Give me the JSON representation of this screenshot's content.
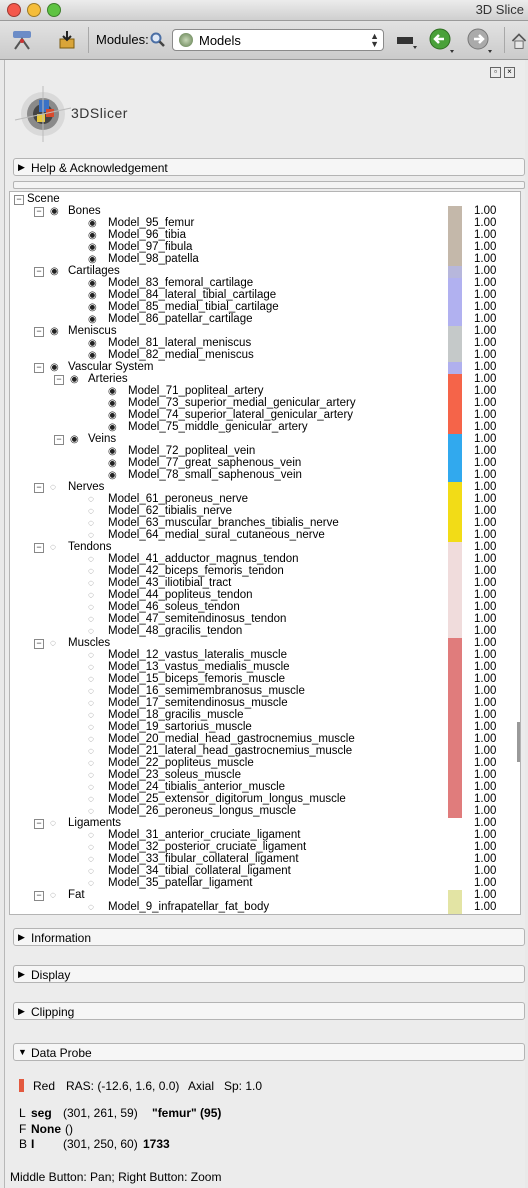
{
  "window": {
    "title": "3D Slice"
  },
  "toolbar": {
    "modules_label": "Modules:",
    "module_selected": "Models",
    "icons": [
      "dicom-icon",
      "save-icon",
      "search-icon",
      "models-icon",
      "layout-icon",
      "back-icon",
      "forward-icon",
      "home-icon"
    ]
  },
  "logo": {
    "text": "3DSlicer"
  },
  "sections": {
    "help": "Help & Acknowledgement",
    "information": "Information",
    "display": "Display",
    "clipping": "Clipping",
    "data_probe": "Data Probe"
  },
  "tree": {
    "root": "Scene",
    "rows": [
      {
        "label": "Bones",
        "type": "group",
        "level": 1,
        "color": "#c4b8aa",
        "opacity": "1.00"
      },
      {
        "label": "Model_95_femur",
        "type": "leaf",
        "level": 2,
        "color": "#c4b8aa",
        "opacity": "1.00"
      },
      {
        "label": "Model_96_tibia",
        "type": "leaf",
        "level": 2,
        "color": "#c4b8aa",
        "opacity": "1.00"
      },
      {
        "label": "Model_97_fibula",
        "type": "leaf",
        "level": 2,
        "color": "#c4b8aa",
        "opacity": "1.00"
      },
      {
        "label": "Model_98_patella",
        "type": "leaf",
        "level": 2,
        "color": "#c4b8aa",
        "opacity": "1.00"
      },
      {
        "label": "Cartilages",
        "type": "group",
        "level": 1,
        "color": "#b7b7dc",
        "opacity": "1.00"
      },
      {
        "label": "Model_83_femoral_cartilage",
        "type": "leaf",
        "level": 2,
        "color": "#b1b1f0",
        "opacity": "1.00"
      },
      {
        "label": "Model_84_lateral_tibial_cartilage",
        "type": "leaf",
        "level": 2,
        "color": "#b1b1f0",
        "opacity": "1.00"
      },
      {
        "label": "Model_85_medial_tibial_cartilage",
        "type": "leaf",
        "level": 2,
        "color": "#b1b1f0",
        "opacity": "1.00"
      },
      {
        "label": "Model_86_patellar_cartilage",
        "type": "leaf",
        "level": 2,
        "color": "#b1b1f0",
        "opacity": "1.00"
      },
      {
        "label": "Meniscus",
        "type": "group",
        "level": 1,
        "color": "#c5c9c9",
        "opacity": "1.00"
      },
      {
        "label": "Model_81_lateral_meniscus",
        "type": "leaf",
        "level": 2,
        "color": "#c5c9c9",
        "opacity": "1.00"
      },
      {
        "label": "Model_82_medial_meniscus",
        "type": "leaf",
        "level": 2,
        "color": "#c5c9c9",
        "opacity": "1.00"
      },
      {
        "label": "Vascular System",
        "type": "group",
        "level": 1,
        "color": "#b0b0ee",
        "opacity": "1.00"
      },
      {
        "label": "Arteries",
        "type": "group",
        "level": 2,
        "color": "#f56449",
        "opacity": "1.00"
      },
      {
        "label": "Model_71_popliteal_artery",
        "type": "leaf",
        "level": 3,
        "color": "#f56449",
        "opacity": "1.00"
      },
      {
        "label": "Model_73_superior_medial_genicular_artery",
        "type": "leaf",
        "level": 3,
        "color": "#f56449",
        "opacity": "1.00"
      },
      {
        "label": "Model_74_superior_lateral_genicular_artery",
        "type": "leaf",
        "level": 3,
        "color": "#f56449",
        "opacity": "1.00"
      },
      {
        "label": "Model_75_middle_genicular_artery",
        "type": "leaf",
        "level": 3,
        "color": "#f56449",
        "opacity": "1.00"
      },
      {
        "label": "Veins",
        "type": "group",
        "level": 2,
        "color": "#31a9ee",
        "opacity": "1.00"
      },
      {
        "label": "Model_72_popliteal_vein",
        "type": "leaf",
        "level": 3,
        "color": "#31a9ee",
        "opacity": "1.00"
      },
      {
        "label": "Model_77_great_saphenous_vein",
        "type": "leaf",
        "level": 3,
        "color": "#31a9ee",
        "opacity": "1.00"
      },
      {
        "label": "Model_78_small_saphenous_vein",
        "type": "leaf",
        "level": 3,
        "color": "#31a9ee",
        "opacity": "1.00"
      },
      {
        "label": "Nerves",
        "type": "hgroup",
        "level": 1,
        "color": "#f2dc17",
        "opacity": "1.00"
      },
      {
        "label": "Model_61_peroneus_nerve",
        "type": "hleaf",
        "level": 2,
        "color": "#f2dc17",
        "opacity": "1.00"
      },
      {
        "label": "Model_62_tibialis_nerve",
        "type": "hleaf",
        "level": 2,
        "color": "#f2dc17",
        "opacity": "1.00"
      },
      {
        "label": "Model_63_muscular_branches_tibialis_nerve",
        "type": "hleaf",
        "level": 2,
        "color": "#f2dc17",
        "opacity": "1.00"
      },
      {
        "label": "Model_64_medial_sural_cutaneous_nerve",
        "type": "hleaf",
        "level": 2,
        "color": "#f2dc17",
        "opacity": "1.00"
      },
      {
        "label": "Tendons",
        "type": "hgroup",
        "level": 1,
        "color": "#f0dcdc",
        "opacity": "1.00"
      },
      {
        "label": "Model_41_adductor_magnus_tendon",
        "type": "hleaf",
        "level": 2,
        "color": "#f0dcdc",
        "opacity": "1.00"
      },
      {
        "label": "Model_42_biceps_femoris_tendon",
        "type": "hleaf",
        "level": 2,
        "color": "#f0dcdc",
        "opacity": "1.00"
      },
      {
        "label": "Model_43_iliotibial_tract",
        "type": "hleaf",
        "level": 2,
        "color": "#f0dcdc",
        "opacity": "1.00"
      },
      {
        "label": "Model_44_popliteus_tendon",
        "type": "hleaf",
        "level": 2,
        "color": "#f0dcdc",
        "opacity": "1.00"
      },
      {
        "label": "Model_46_soleus_tendon",
        "type": "hleaf",
        "level": 2,
        "color": "#f0dcdc",
        "opacity": "1.00"
      },
      {
        "label": "Model_47_semitendinosus_tendon",
        "type": "hleaf",
        "level": 2,
        "color": "#f0dcdc",
        "opacity": "1.00"
      },
      {
        "label": "Model_48_gracilis_tendon",
        "type": "hleaf",
        "level": 2,
        "color": "#f0dcdc",
        "opacity": "1.00"
      },
      {
        "label": "Muscles",
        "type": "hgroup",
        "level": 1,
        "color": "#e07c7c",
        "opacity": "1.00"
      },
      {
        "label": "Model_12_vastus_lateralis_muscle",
        "type": "hleaf",
        "level": 2,
        "color": "#e07c7c",
        "opacity": "1.00"
      },
      {
        "label": "Model_13_vastus_medialis_muscle",
        "type": "hleaf",
        "level": 2,
        "color": "#e07c7c",
        "opacity": "1.00"
      },
      {
        "label": "Model_15_biceps_femoris_muscle",
        "type": "hleaf",
        "level": 2,
        "color": "#e07c7c",
        "opacity": "1.00"
      },
      {
        "label": "Model_16_semimembranosus_muscle",
        "type": "hleaf",
        "level": 2,
        "color": "#e07c7c",
        "opacity": "1.00"
      },
      {
        "label": "Model_17_semitendinosus_muscle",
        "type": "hleaf",
        "level": 2,
        "color": "#e07c7c",
        "opacity": "1.00"
      },
      {
        "label": "Model_18_gracilis_muscle",
        "type": "hleaf",
        "level": 2,
        "color": "#e07c7c",
        "opacity": "1.00"
      },
      {
        "label": "Model_19_sartorius_muscle",
        "type": "hleaf",
        "level": 2,
        "color": "#e07c7c",
        "opacity": "1.00"
      },
      {
        "label": "Model_20_medial_head_gastrocnemius_muscle",
        "type": "hleaf",
        "level": 2,
        "color": "#e07c7c",
        "opacity": "1.00"
      },
      {
        "label": "Model_21_lateral_head_gastrocnemius_muscle",
        "type": "hleaf",
        "level": 2,
        "color": "#e07c7c",
        "opacity": "1.00"
      },
      {
        "label": "Model_22_popliteus_muscle",
        "type": "hleaf",
        "level": 2,
        "color": "#e07c7c",
        "opacity": "1.00"
      },
      {
        "label": "Model_23_soleus_muscle",
        "type": "hleaf",
        "level": 2,
        "color": "#e07c7c",
        "opacity": "1.00"
      },
      {
        "label": "Model_24_tibialis_anterior_muscle",
        "type": "hleaf",
        "level": 2,
        "color": "#e07c7c",
        "opacity": "1.00"
      },
      {
        "label": "Model_25_extensor_digitorum_longus_muscle",
        "type": "hleaf",
        "level": 2,
        "color": "#e07c7c",
        "opacity": "1.00"
      },
      {
        "label": "Model_26_peroneus_longus_muscle",
        "type": "hleaf",
        "level": 2,
        "color": "#e07c7c",
        "opacity": "1.00"
      },
      {
        "label": "Ligaments",
        "type": "hgroup",
        "level": 1,
        "color": "",
        "opacity": "1.00"
      },
      {
        "label": "Model_31_anterior_cruciate_ligament",
        "type": "hleaf",
        "level": 2,
        "color": "",
        "opacity": "1.00"
      },
      {
        "label": "Model_32_posterior_cruciate_ligament",
        "type": "hleaf",
        "level": 2,
        "color": "",
        "opacity": "1.00"
      },
      {
        "label": "Model_33_fibular_collateral_ligament",
        "type": "hleaf",
        "level": 2,
        "color": "",
        "opacity": "1.00"
      },
      {
        "label": "Model_34_tibial_collateral_ligament",
        "type": "hleaf",
        "level": 2,
        "color": "",
        "opacity": "1.00"
      },
      {
        "label": "Model_35_patellar_ligament",
        "type": "hleaf",
        "level": 2,
        "color": "",
        "opacity": "1.00"
      },
      {
        "label": "Fat",
        "type": "hgroup",
        "level": 1,
        "color": "#e3e4a4",
        "opacity": "1.00"
      },
      {
        "label": "Model_9_infrapatellar_fat_body",
        "type": "hleaf",
        "level": 2,
        "color": "#e3e4a4",
        "opacity": "1.00"
      }
    ]
  },
  "probe": {
    "view_color": "#e3593f",
    "view": "Red",
    "ras": "RAS: (-12.6, 1.6, 0.0)",
    "orient": "Axial",
    "spacing": "Sp: 1.0",
    "l_prefix": "L",
    "l_name": "seg",
    "l_coords": "(301, 261, 59)",
    "l_value": "\"femur\" (95)",
    "f_prefix": "F",
    "f_name": "None",
    "f_coords": "()",
    "b_prefix": "B",
    "b_name": "I",
    "b_coords": "(301, 250, 60)",
    "b_value": "1733",
    "hint": "Middle Button: Pan; Right Button: Zoom"
  }
}
